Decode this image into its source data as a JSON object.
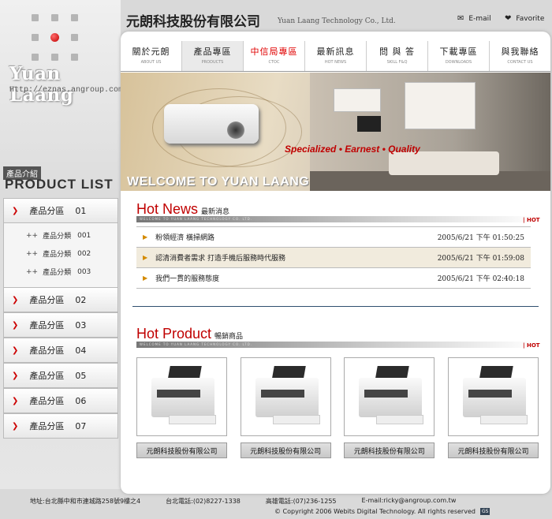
{
  "logo": {
    "text": "Yuan Laang",
    "url": "Http://eznas.angroup.com.tw"
  },
  "header": {
    "company_zh": "元朗科技股份有限公司",
    "company_en": "Yuan Laang Technology Co., Ltd.",
    "email_label": "E-mail",
    "favorite_label": "Favorite"
  },
  "nav": [
    {
      "zh": "關於元朗",
      "en": "ABOUT US"
    },
    {
      "zh": "產品專區",
      "en": "PRODUCTS"
    },
    {
      "zh": "中信局專區",
      "en": "CTOC"
    },
    {
      "zh": "最新訊息",
      "en": "HOT NEWS"
    },
    {
      "zh": "問 與 答",
      "en": "SKILL F&Q"
    },
    {
      "zh": "下載專區",
      "en": "DOWNLOADS"
    },
    {
      "zh": "與我聯絡",
      "en": "CONTACT US"
    }
  ],
  "banner": {
    "slogan": "Specialized • Earnest • Quality",
    "welcome": "WELCOME  TO YUAN LAANG"
  },
  "sidebar": {
    "intro_label": "產品介紹",
    "title": "PRODUCT  LIST",
    "categories": [
      {
        "label": "產品分區",
        "num": "01"
      },
      {
        "label": "產品分區",
        "num": "02"
      },
      {
        "label": "產品分區",
        "num": "03"
      },
      {
        "label": "產品分區",
        "num": "04"
      },
      {
        "label": "產品分區",
        "num": "05"
      },
      {
        "label": "產品分區",
        "num": "06"
      },
      {
        "label": "產品分區",
        "num": "07"
      }
    ],
    "subcategories": [
      {
        "label": "產品分類",
        "num": "001"
      },
      {
        "label": "產品分類",
        "num": "002"
      },
      {
        "label": "產品分類",
        "num": "003"
      }
    ]
  },
  "news": {
    "title": "Hot News",
    "title_zh": "最新消息",
    "bar_text": "WELCOME TO YUAN LAANG TECHNOLOGY CO. LTD.",
    "hot_tag": "| HOT",
    "items": [
      {
        "title": "粉領經濟 橫掃網路",
        "date": "2005/6/21 下午 01:50:25"
      },
      {
        "title": "認清消費者需求 打造手機后服務時代服務",
        "date": "2005/6/21 下午 01:59:08"
      },
      {
        "title": "我們一貫的服務態度",
        "date": "2005/6/21 下午 02:40:18"
      }
    ]
  },
  "products": {
    "title": "Hot Product",
    "title_zh": "暢銷商品",
    "bar_text": "WELCOME TO YUAN LAANG TECHNOLOGY CO. LTD.",
    "hot_tag": "| HOT",
    "items": [
      {
        "name": "元朗科技股份有限公司"
      },
      {
        "name": "元朗科技股份有限公司"
      },
      {
        "name": "元朗科技股份有限公司"
      },
      {
        "name": "元朗科技股份有限公司"
      }
    ]
  },
  "footer": {
    "address": "地址:台北縣中和市連城路258號9樓之4",
    "taipei_phone": "台北電話:(02)8227-1338",
    "kaohsiung_phone": "高雄電話:(07)236-1255",
    "email": "E-mail:ricky@angroup.com.tw",
    "copyright": "© Copyright 2006 Webits Digital Technology. All rights reserved",
    "badge": "GS"
  },
  "colors": {
    "accent": "#c00000",
    "hot_news_highlight": "#f1ebdd",
    "divider": "#2f4f6f"
  }
}
